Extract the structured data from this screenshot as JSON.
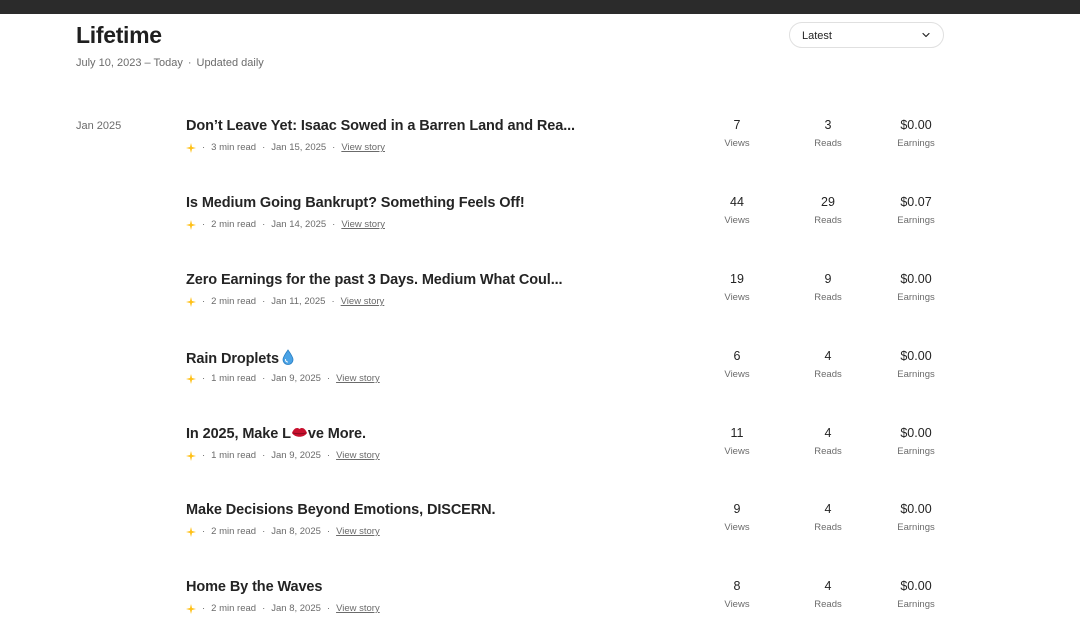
{
  "header": {
    "title": "Lifetime",
    "date_range": "July 10, 2023 – Today",
    "separator": "·",
    "update_note": "Updated daily"
  },
  "sort_select": {
    "value": "Latest",
    "icon": "chevron-down-icon"
  },
  "month_label": "Jan 2025",
  "labels": {
    "views": "Views",
    "reads": "Reads",
    "earnings": "Earnings",
    "view_story": "View story",
    "dot": "·"
  },
  "accent_color": "#FFC017",
  "stories": [
    {
      "title": "Don’t Leave Yet: Isaac Sowed in a Barren Land and Rea...",
      "read_time": "3 min read",
      "date": "Jan 15, 2025",
      "views": "7",
      "reads": "3",
      "earnings": "$0.00"
    },
    {
      "title": "Is Medium Going Bankrupt? Something Feels Off!",
      "read_time": "2 min read",
      "date": "Jan 14, 2025",
      "views": "44",
      "reads": "29",
      "earnings": "$0.07"
    },
    {
      "title": "Zero Earnings for the past 3 Days. Medium What Coul...",
      "read_time": "2 min read",
      "date": "Jan 11, 2025",
      "views": "19",
      "reads": "9",
      "earnings": "$0.00"
    },
    {
      "title": "Rain Droplets",
      "title_emoji": "droplet-icon",
      "read_time": "1 min read",
      "date": "Jan 9, 2025",
      "views": "6",
      "reads": "4",
      "earnings": "$0.00"
    },
    {
      "title_before": "In 2025, Make L",
      "title_emoji": "lips-icon",
      "title_after": "ve More.",
      "read_time": "1 min read",
      "date": "Jan 9, 2025",
      "views": "11",
      "reads": "4",
      "earnings": "$0.00"
    },
    {
      "title": "Make Decisions Beyond Emotions, DISCERN.",
      "read_time": "2 min read",
      "date": "Jan 8, 2025",
      "views": "9",
      "reads": "4",
      "earnings": "$0.00"
    },
    {
      "title": "Home By the Waves",
      "read_time": "2 min read",
      "date": "Jan 8, 2025",
      "views": "8",
      "reads": "4",
      "earnings": "$0.00"
    }
  ]
}
